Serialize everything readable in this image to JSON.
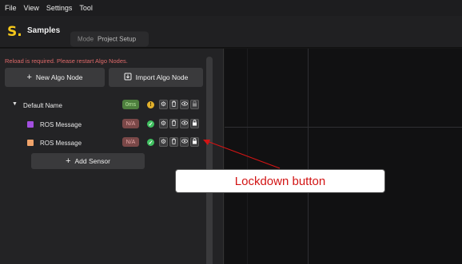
{
  "menu": {
    "items": [
      "File",
      "View",
      "Settings",
      "Tool"
    ]
  },
  "header": {
    "logo": "S.",
    "title": "Samples",
    "mode_label": "Mode",
    "mode_value": "Project Setup"
  },
  "sidebar": {
    "error": "Reload is required. Please restart Algo Nodes.",
    "new_node_label": "New Algo Node",
    "import_node_label": "Import Algo Node",
    "add_sensor_label": "Add Sensor",
    "tree": {
      "root": {
        "name": "Default Name",
        "badge": "0ms",
        "status": "!"
      },
      "children": [
        {
          "name": "ROS Message",
          "badge": "N/A",
          "status": "✓",
          "color": "#a34fe0"
        },
        {
          "name": "ROS Message",
          "badge": "N/A",
          "status": "✓",
          "color": "#f0a36a"
        }
      ]
    }
  },
  "annotation": {
    "label": "Lockdown button",
    "color": "#d21414"
  },
  "icons": [
    "gear-icon",
    "trash-icon",
    "eye-icon",
    "lock-icon",
    "plus-icon",
    "import-icon",
    "caret-down-icon"
  ]
}
